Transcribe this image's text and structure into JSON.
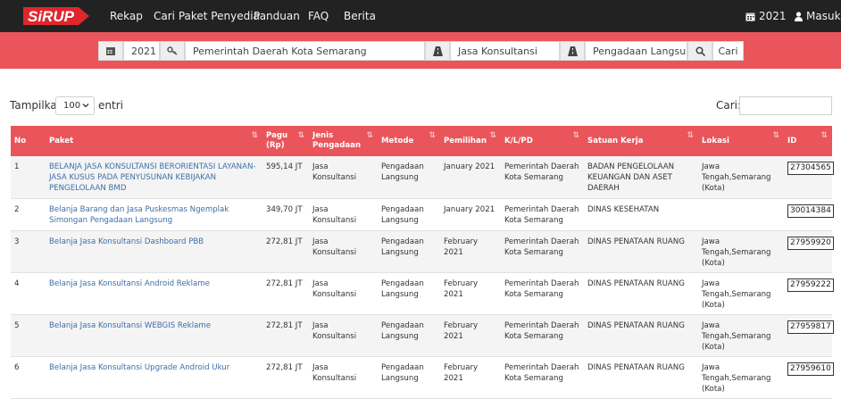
{
  "navbar": {
    "logo_text": "SiRUP",
    "items": [
      "Rekap",
      "Cari Paket Penyedia",
      "Panduan",
      "FAQ",
      "Berita"
    ],
    "year": "2021",
    "login": "Masuk"
  },
  "filter": {
    "year": "2021",
    "kldi": "Pemerintah Daerah Kota Semarang",
    "jenis": "Jasa Konsultansi",
    "metode": "Pengadaan Langsung",
    "search_button": "Cari"
  },
  "controls": {
    "show_label": "Tampilkan",
    "entries_value": "100",
    "entries_suffix": "entri",
    "search_label": "Cari:"
  },
  "table": {
    "headers": [
      "No",
      "Paket",
      "Pagu (Rp)",
      "Jenis Pengadaan",
      "Metode",
      "Pemilihan",
      "K/L/PD",
      "Satuan Kerja",
      "Lokasi",
      "ID"
    ],
    "rows": [
      {
        "no": "1",
        "paket": "BELANJA JASA KONSULTANSI BERORIENTASI LAYANAN-JASA KUSUS PADA PENYUSUNAN KEBIJAKAN PENGELOLAAN BMD",
        "pagu": "595,14 JT",
        "jenis": "Jasa Konsultansi",
        "metode": "Pengadaan Langsung",
        "pemilihan": "January 2021",
        "klpd": "Pemerintah Daerah Kota Semarang",
        "satker": "BADAN PENGELOLAAN KEUANGAN DAN ASET DAERAH",
        "lokasi": "Jawa Tengah,Semarang (Kota)",
        "id": "27304565"
      },
      {
        "no": "2",
        "paket": "Belanja Barang dan Jasa Puskesmas Ngemplak Simongan Pengadaan Langsung",
        "pagu": "349,70 JT",
        "jenis": "Jasa Konsultansi",
        "metode": "Pengadaan Langsung",
        "pemilihan": "January 2021",
        "klpd": "Pemerintah Daerah Kota Semarang",
        "satker": "DINAS KESEHATAN",
        "lokasi": "",
        "id": "30014384"
      },
      {
        "no": "3",
        "paket": "Belanja Jasa Konsultansi Dashboard PBB",
        "pagu": "272,81 JT",
        "jenis": "Jasa Konsultansi",
        "metode": "Pengadaan Langsung",
        "pemilihan": "February 2021",
        "klpd": "Pemerintah Daerah Kota Semarang",
        "satker": "DINAS PENATAAN RUANG",
        "lokasi": "Jawa Tengah,Semarang (Kota)",
        "id": "27959920"
      },
      {
        "no": "4",
        "paket": "Belanja Jasa Konsultansi Android Reklame",
        "pagu": "272,81 JT",
        "jenis": "Jasa Konsultansi",
        "metode": "Pengadaan Langsung",
        "pemilihan": "February 2021",
        "klpd": "Pemerintah Daerah Kota Semarang",
        "satker": "DINAS PENATAAN RUANG",
        "lokasi": "Jawa Tengah,Semarang (Kota)",
        "id": "27959222"
      },
      {
        "no": "5",
        "paket": "Belanja Jasa Konsultansi WEBGIS Reklame",
        "pagu": "272,81 JT",
        "jenis": "Jasa Konsultansi",
        "metode": "Pengadaan Langsung",
        "pemilihan": "February 2021",
        "klpd": "Pemerintah Daerah Kota Semarang",
        "satker": "DINAS PENATAAN RUANG",
        "lokasi": "Jawa Tengah,Semarang (Kota)",
        "id": "27959817"
      },
      {
        "no": "6",
        "paket": "Belanja Jasa Konsultansi Upgrade Android Ukur",
        "pagu": "272,81 JT",
        "jenis": "Jasa Konsultansi",
        "metode": "Pengadaan Langsung",
        "pemilihan": "February 2021",
        "klpd": "Pemerintah Daerah Kota Semarang",
        "satker": "DINAS PENATAAN RUANG",
        "lokasi": "Jawa Tengah,Semarang (Kota)",
        "id": "27959610"
      }
    ]
  }
}
